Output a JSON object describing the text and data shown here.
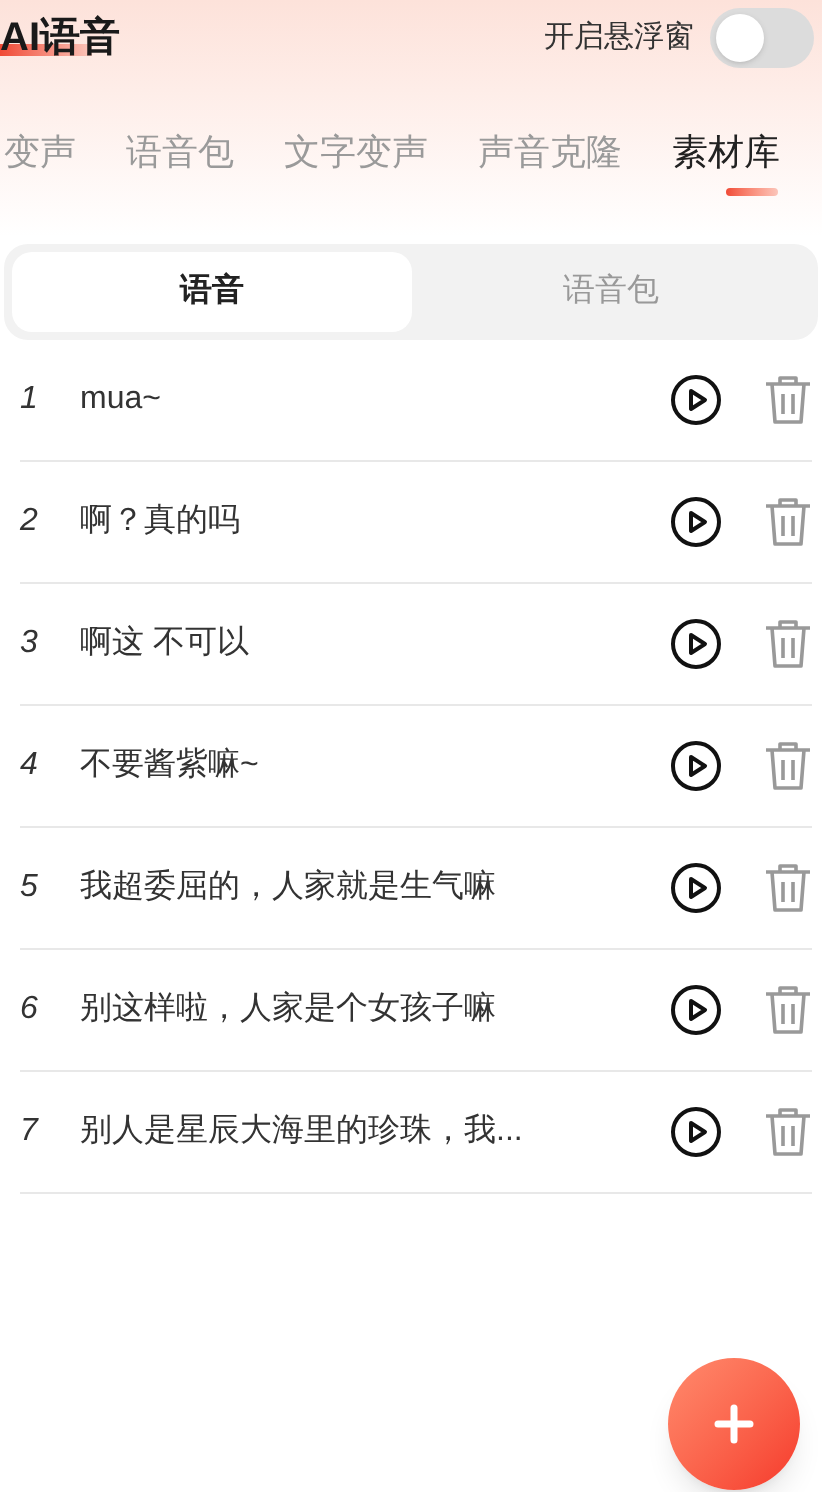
{
  "header": {
    "title": "AI语音",
    "float_window": {
      "label": "开启悬浮窗",
      "on": false
    }
  },
  "tabs": [
    {
      "label": "变声",
      "selected": false
    },
    {
      "label": "语音包",
      "selected": false
    },
    {
      "label": "文字变声",
      "selected": false
    },
    {
      "label": "声音克隆",
      "selected": false
    },
    {
      "label": "素材库",
      "selected": true
    }
  ],
  "segments": [
    {
      "label": "语音",
      "selected": true
    },
    {
      "label": "语音包",
      "selected": false
    }
  ],
  "items": [
    {
      "index": "1",
      "text": "mua~"
    },
    {
      "index": "2",
      "text": "啊？真的吗"
    },
    {
      "index": "3",
      "text": "啊这 不可以"
    },
    {
      "index": "4",
      "text": "不要酱紫嘛~"
    },
    {
      "index": "5",
      "text": "我超委屈的，人家就是生气嘛"
    },
    {
      "index": "6",
      "text": "别这样啦，人家是个女孩子嘛"
    },
    {
      "index": "7",
      "text": "别人是星辰大海里的珍珠，我..."
    }
  ]
}
